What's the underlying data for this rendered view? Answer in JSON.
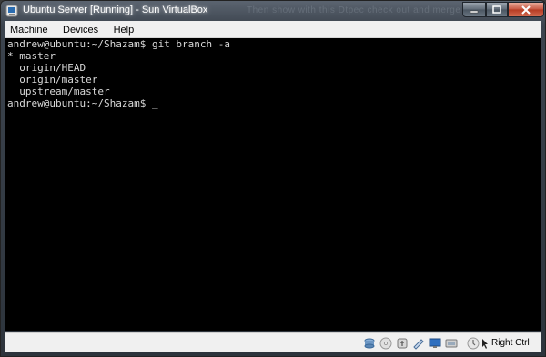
{
  "window": {
    "title": "Ubuntu Server [Running] - Sun VirtualBox",
    "background_title": "Then show with this Dtpec check out and merge ...",
    "accent_close": "#c7553f"
  },
  "menu": [
    {
      "label": "Machine"
    },
    {
      "label": "Devices"
    },
    {
      "label": "Help"
    }
  ],
  "terminal": {
    "lines": [
      "andrew@ubuntu:~/Shazam$ git branch -a",
      "* master",
      "  origin/HEAD",
      "  origin/master",
      "  upstream/master",
      "andrew@ubuntu:~/Shazam$ _"
    ],
    "text_color": "#d8d8d8",
    "background": "#000000"
  },
  "statusbar": {
    "icons": [
      "hard-disk-icon",
      "optical-drive-icon",
      "usb-icon",
      "shared-folders-icon",
      "network-icon",
      "display-icon",
      "mouse-integration-icon",
      "host-key-icon"
    ],
    "host_key_label": "Right Ctrl"
  }
}
